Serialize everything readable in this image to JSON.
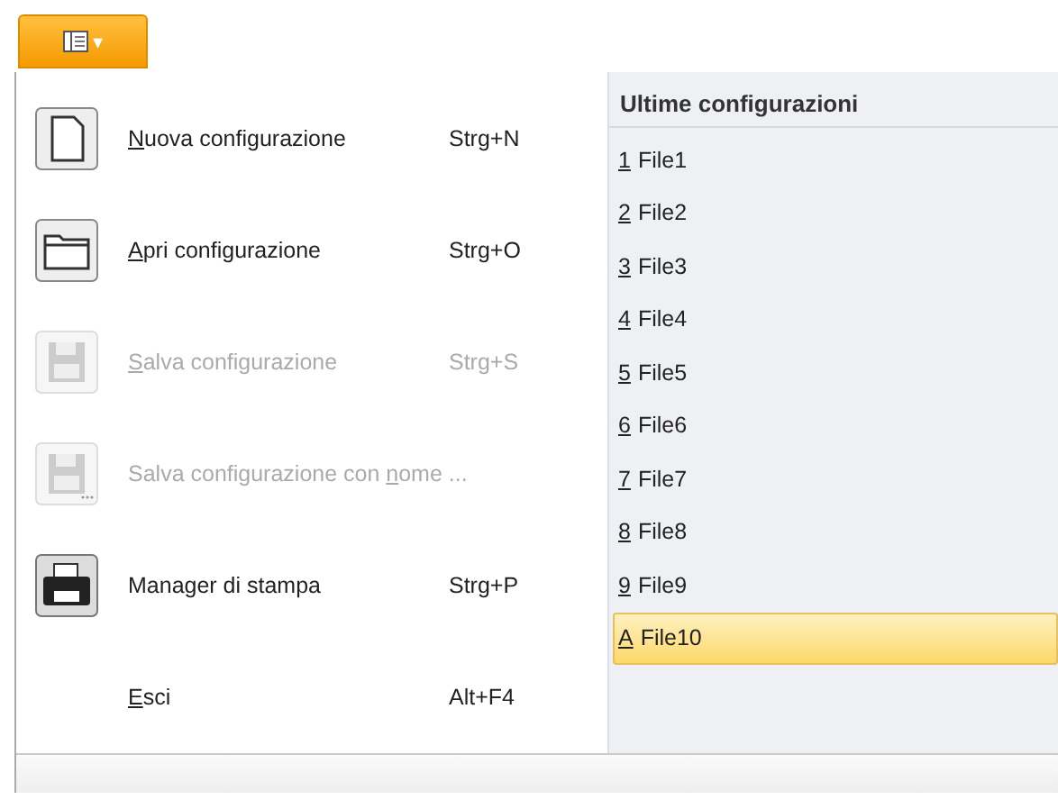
{
  "app_button": {
    "label": "▾"
  },
  "menu": {
    "items": [
      {
        "kind": "new",
        "key": "N",
        "after": "uova configurazione",
        "shortcut": "Strg+N",
        "disabled": false
      },
      {
        "kind": "open",
        "key": "A",
        "after": "pri configurazione",
        "shortcut": "Strg+O",
        "disabled": false
      },
      {
        "kind": "save",
        "key": "S",
        "after": "alva configurazione",
        "shortcut": "Strg+S",
        "disabled": true
      },
      {
        "kind": "save-as",
        "before": "Salva configurazione con ",
        "key": "n",
        "after": "ome ...",
        "disabled": true
      },
      {
        "kind": "print",
        "before": "Manager di stampa",
        "shortcut": "Strg+P",
        "disabled": false
      },
      {
        "kind": "none",
        "key": "E",
        "after": "sci",
        "shortcut": "Alt+F4",
        "disabled": false
      }
    ]
  },
  "recent": {
    "title": "Ultime configurazioni",
    "items": [
      {
        "key": "1",
        "name": "File1",
        "selected": false
      },
      {
        "key": "2",
        "name": "File2",
        "selected": false
      },
      {
        "key": "3",
        "name": "File3",
        "selected": false
      },
      {
        "key": "4",
        "name": "File4",
        "selected": false
      },
      {
        "key": "5",
        "name": "File5",
        "selected": false
      },
      {
        "key": "6",
        "name": "File6",
        "selected": false
      },
      {
        "key": "7",
        "name": "File7",
        "selected": false
      },
      {
        "key": "8",
        "name": "File8",
        "selected": false
      },
      {
        "key": "9",
        "name": "File9",
        "selected": false
      },
      {
        "key": "A",
        "name": "File10",
        "selected": true
      }
    ]
  }
}
